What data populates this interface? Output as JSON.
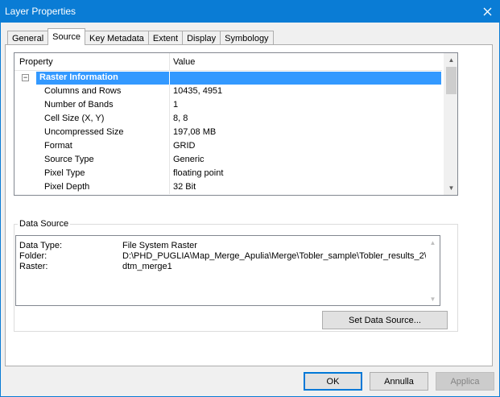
{
  "window": {
    "title": "Layer Properties",
    "close_glyph": "✕"
  },
  "tabs": [
    {
      "label": "General"
    },
    {
      "label": "Source",
      "active": true
    },
    {
      "label": "Key Metadata"
    },
    {
      "label": "Extent"
    },
    {
      "label": "Display"
    },
    {
      "label": "Symbology"
    }
  ],
  "grid": {
    "header_property": "Property",
    "header_value": "Value",
    "category": {
      "label": "Raster Information",
      "expander": "−"
    },
    "rows": [
      {
        "label": "Columns and Rows",
        "value": "10435, 4951"
      },
      {
        "label": "Number of Bands",
        "value": "1"
      },
      {
        "label": "Cell Size (X, Y)",
        "value": "8, 8"
      },
      {
        "label": "Uncompressed Size",
        "value": "197,08 MB"
      },
      {
        "label": "Format",
        "value": "GRID"
      },
      {
        "label": "Source Type",
        "value": "Generic"
      },
      {
        "label": "Pixel Type",
        "value": "floating point"
      },
      {
        "label": "Pixel Depth",
        "value": "32 Bit"
      }
    ]
  },
  "data_source": {
    "legend": "Data Source",
    "rows": [
      {
        "key": "Data Type:",
        "value": "File System Raster"
      },
      {
        "key": "Folder:",
        "value": "D:\\PHD_PUGLIA\\Map_Merge_Apulia\\Merge\\Tobler_sample\\Tobler_results_2\\"
      },
      {
        "key": "Raster:",
        "value": "dtm_merge1"
      }
    ],
    "set_button": "Set Data Source..."
  },
  "footer": {
    "ok": "OK",
    "cancel": "Annulla",
    "apply": "Applica"
  },
  "colors": {
    "titlebar": "#0a7cd5",
    "selection": "#3399ff"
  }
}
